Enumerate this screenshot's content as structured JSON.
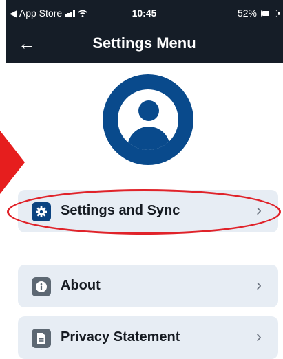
{
  "status_bar": {
    "carrier": "◀ App Store",
    "time": "10:45",
    "battery_percent_label": "52%",
    "battery_level": 0.52
  },
  "header": {
    "back_icon": "←",
    "title": "Settings Menu"
  },
  "menu": {
    "items": [
      {
        "label": "Settings and Sync",
        "icon": "gear-icon",
        "chevron": "›"
      },
      {
        "label": "About",
        "icon": "info-icon",
        "chevron": "›"
      },
      {
        "label": "Privacy Statement",
        "icon": "document-icon",
        "chevron": "›"
      }
    ]
  },
  "colors": {
    "header_bg": "#151d27",
    "avatar_blue": "#094a8c",
    "row_bg": "#e7edf4",
    "annotation_red": "#e0232a"
  }
}
